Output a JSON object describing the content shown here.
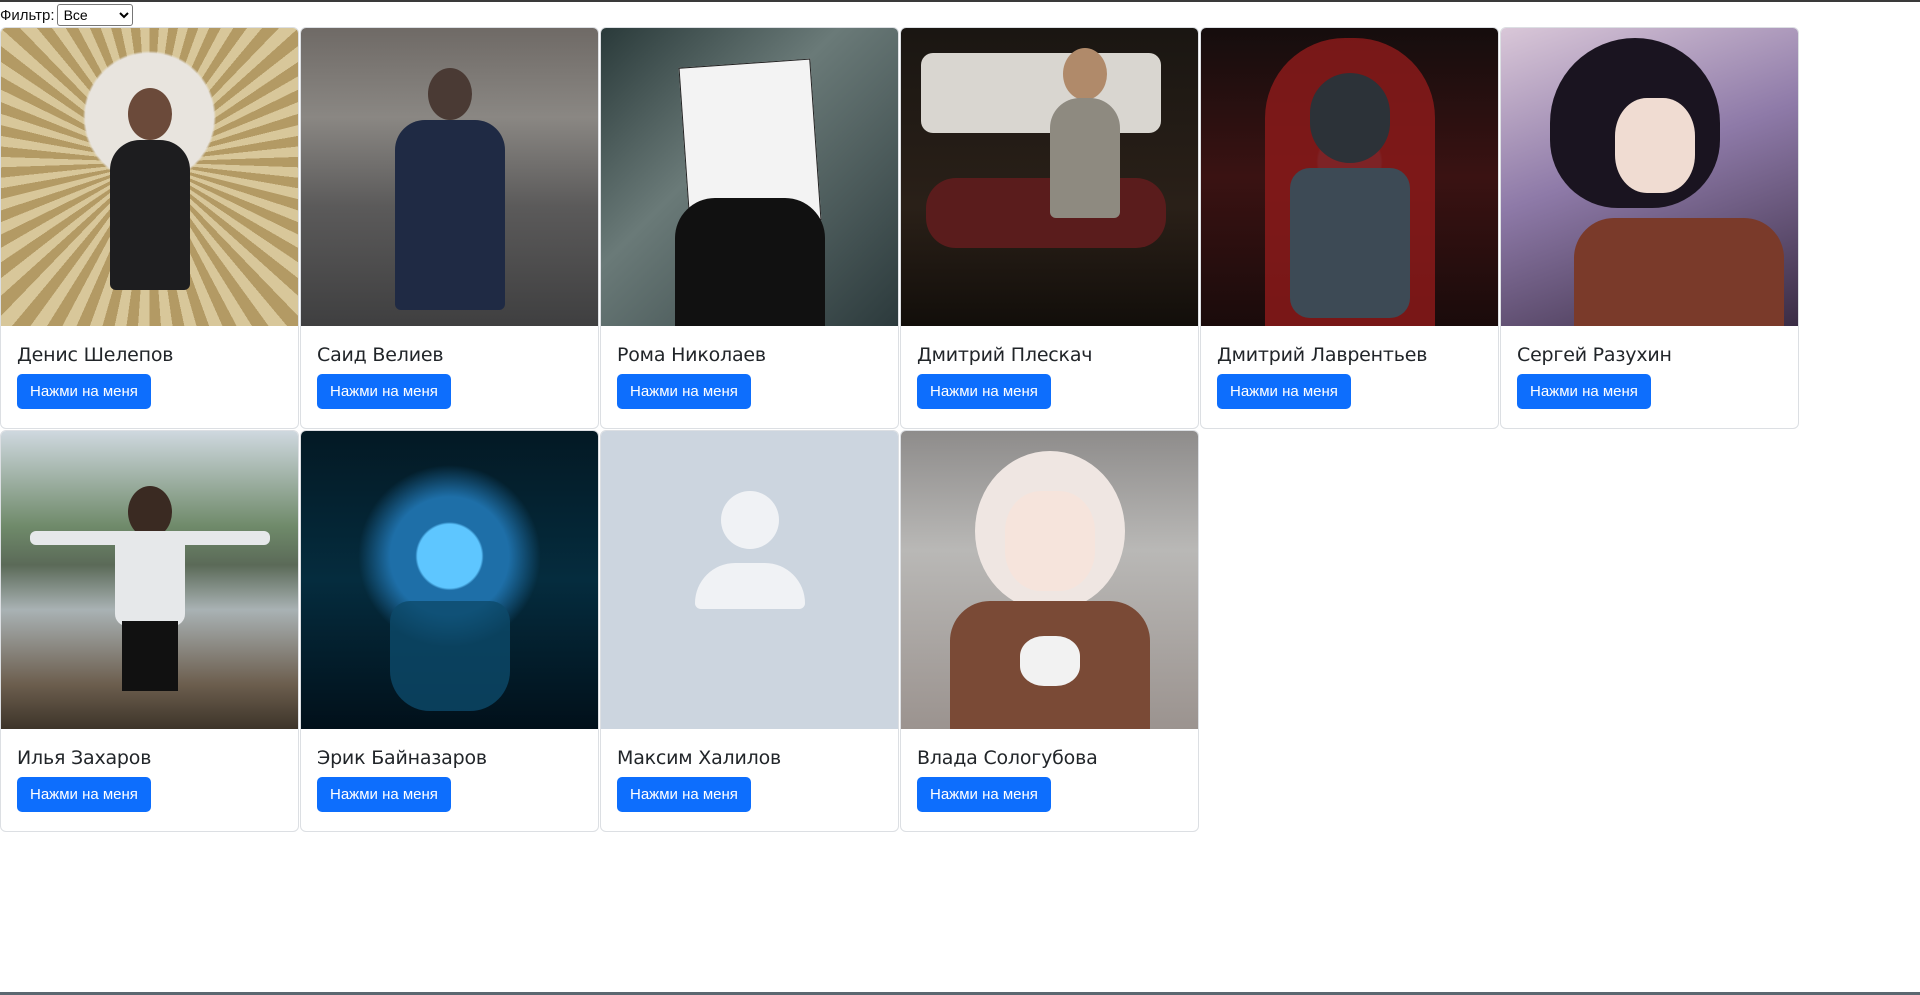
{
  "filter": {
    "label": "Фильтр:",
    "selected": "Все"
  },
  "cards": [
    {
      "name": "Денис Шелепов",
      "button": "Нажми на меня",
      "image": "photo-man-golden-wings"
    },
    {
      "name": "Саид Велиев",
      "button": "Нажми на меня",
      "image": "photo-man-on-sofa"
    },
    {
      "name": "Рома Николаев",
      "button": "Нажми на меня",
      "image": "anime-mask-art"
    },
    {
      "name": "Дмитрий Плескач",
      "button": "Нажми на меня",
      "image": "photo-man-motorcycle"
    },
    {
      "name": "Дмитрий Лаврентьев",
      "button": "Нажми на меня",
      "image": "robot-red-hood-art"
    },
    {
      "name": "Сергей Разухин",
      "button": "Нажми на меня",
      "image": "anime-girl-skeleton"
    },
    {
      "name": "Илья Захаров",
      "button": "Нажми на меня",
      "image": "photo-man-lake"
    },
    {
      "name": "Эрик Байназаров",
      "button": "Нажми на меня",
      "image": "blue-crystal-rose"
    },
    {
      "name": "Максим Халилов",
      "button": "Нажми на меня",
      "image": "default-avatar-icon"
    },
    {
      "name": "Влада Сологубова",
      "button": "Нажми на меня",
      "image": "anime-girl-with-cat"
    }
  ]
}
